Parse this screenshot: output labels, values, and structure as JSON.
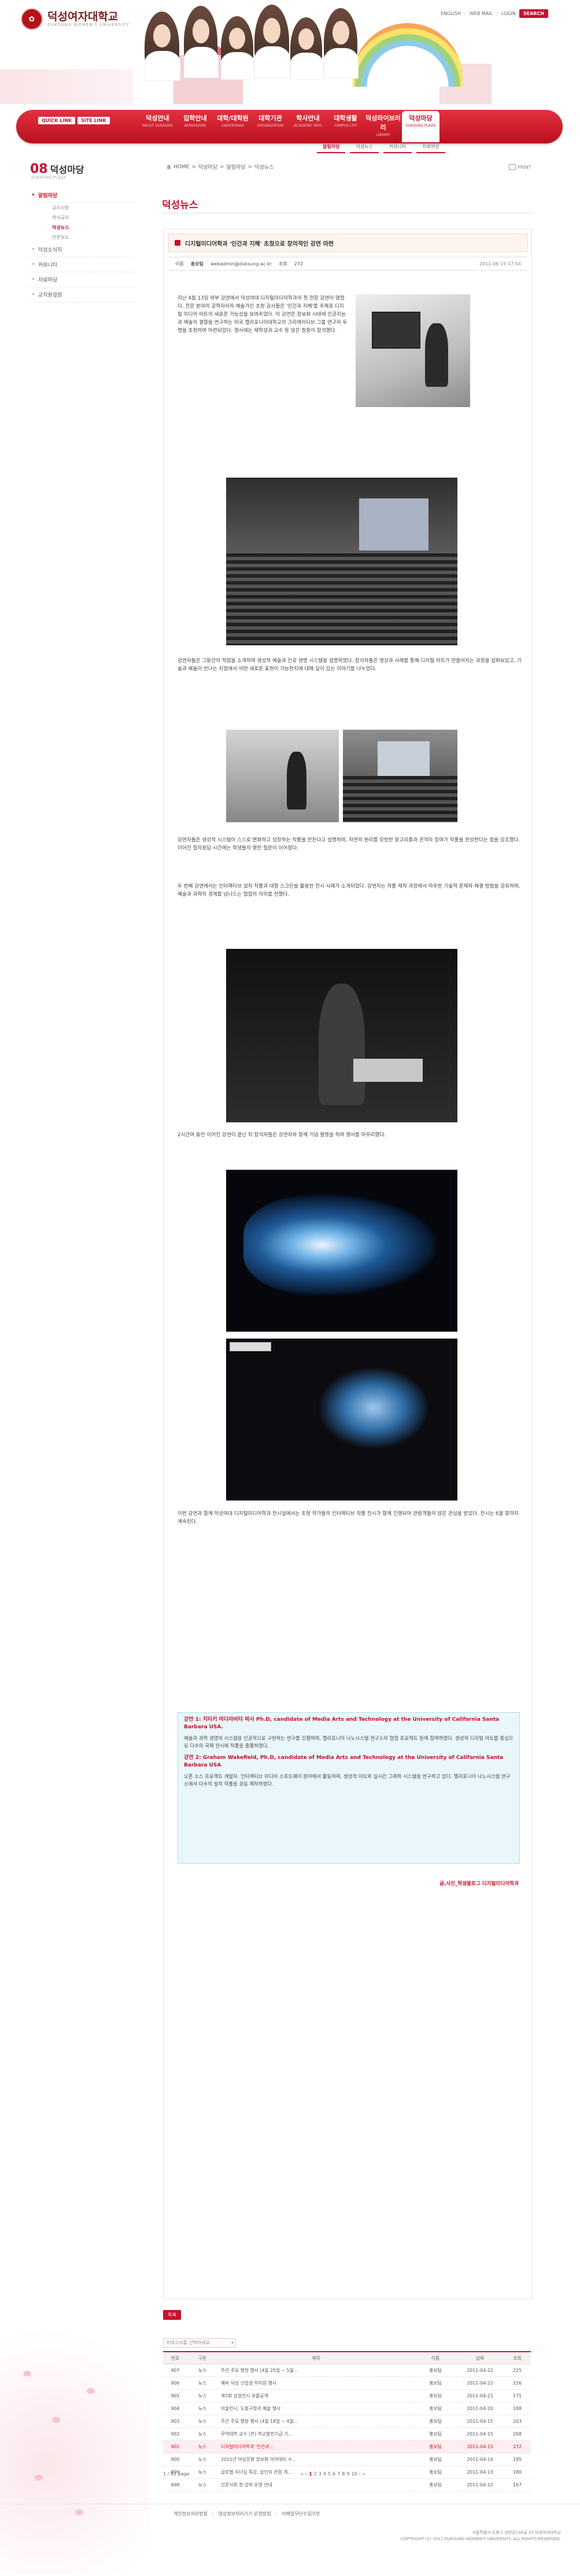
{
  "header": {
    "logo_text": "덕성여자대학교",
    "logo_sub": "DUKSUNG WOMEN'S UNIVERSITY",
    "util_links": [
      "ENGLISH",
      "WEB MAIL",
      "LOGIN"
    ],
    "search_label": "SEARCH",
    "quick_links": [
      "QUICK LINK",
      "SITE LINK"
    ],
    "menu": [
      {
        "label": "덕성안내",
        "sub": "ABOUT DUKSUNG"
      },
      {
        "label": "입학안내",
        "sub": "ADMISSIONS"
      },
      {
        "label": "대학/대학원",
        "sub": "UNDERGRAD"
      },
      {
        "label": "대학기관",
        "sub": "ORGANIZATION"
      },
      {
        "label": "학사안내",
        "sub": "ACADEMIC INFO"
      },
      {
        "label": "대학생활",
        "sub": "CAMPUS LIFE"
      },
      {
        "label": "덕성라이브러리",
        "sub": "LIBRARY"
      },
      {
        "label": "덕성마당",
        "sub": "DUKSUNG PLAZA"
      }
    ],
    "submenu": [
      "알림마당",
      "덕성뉴스",
      "커뮤니티",
      "자료마당"
    ]
  },
  "left_nav": {
    "number": "08",
    "title": "덕성마당",
    "subtitle": "DUKSUNG PLAZA",
    "items": [
      {
        "label": "알림마당",
        "active": true,
        "children": [
          {
            "label": "공지사항",
            "active": false
          },
          {
            "label": "학사공지",
            "active": false
          },
          {
            "label": "덕성뉴스",
            "active": true
          },
          {
            "label": "언론보도",
            "active": false
          }
        ]
      },
      {
        "label": "덕성소식지",
        "active": false,
        "children": []
      },
      {
        "label": "커뮤니티",
        "active": false,
        "children": []
      },
      {
        "label": "자료마당",
        "active": false,
        "children": []
      },
      {
        "label": "교직원광장",
        "active": false,
        "children": []
      }
    ]
  },
  "breadcrumb": [
    "HOME",
    "덕성마당",
    "알림마당",
    "덕성뉴스"
  ],
  "print_label": "PRINT",
  "page_title": "덕성뉴스",
  "article": {
    "title": "디지털미디어학과 '인간과 지혜' 초청으로 창의적인 강연 마련",
    "meta": {
      "author_label": "이름",
      "author": "홍보팀",
      "email": "webadmin@duksung.ac.kr",
      "hits_label": "조회",
      "hits": "272",
      "date": "2011-06-15 17:54"
    },
    "paragraph_1": "지난 4월 13일 외부 강연에서 덕성여대 디지털미디어학과의 첫 전문 강연이 열렸다. 전문 분야의 공학자이자 예술가인 초청 강사들은 '인간과 지혜'를 주제로 디지털 미디어 아트의 새로운 가능성을 보여주었다. 이 강연은 정보화 시대에 인공지능과 예술의 결합을 연구하는 미국 캘리포니아대학교의 크리에이티브 그룹 연구자 두 명을 초청하여 마련되었다. 행사에는 재학생과 교수 등 많은 청중이 참석했다.",
    "paragraph_2": "강연자들은 그동안의 작업을 소개하며 생성적 예술과 인공 생명 시스템을 설명하였다. 참석자들은 영상과 사례를 통해 디지털 아트가 만들어지는 과정을 살펴보았고, 기술과 예술이 만나는 지점에서 어떤 새로운 표현이 가능한지에 대해 깊이 있는 이야기를 나누었다.",
    "paragraph_3": "강연자들은 생성적 시스템이 스스로 변화하고 성장하는 작품을 만든다고 설명하며, 자연의 원리를 모방한 알고리즘과 관객의 참여가 작품을 완성한다는 점을 강조했다. 이어진 질의응답 시간에는 학생들의 열띤 질문이 이어졌다.",
    "paragraph_4": "두 번째 강연에서는 인터랙티브 설치 작품과 대형 스크린을 활용한 전시 사례가 소개되었다. 강연자는 작품 제작 과정에서 마주한 기술적 문제와 해결 방법을 공유하며, 예술과 과학의 경계를 넘나드는 협업의 의미를 전했다.",
    "paragraph_5": "2시간여 동안 이어진 강연이 끝난 뒤 참석자들은 강연자와 함께 기념 촬영을 하며 행사를 마무리했다.",
    "paragraph_6": "이번 강연과 함께 덕성여대 디지털미디어학과 전시실에서는 초청 작가들의 인터랙티브 작품 전시가 함께 진행되어 관람객들의 많은 관심을 받았다. 전시는 6월 말까지 계속된다.",
    "box_head_1": "강연 1: 지타키 마다라비타 박사 Ph.D, candidate of Media Arts and Technology at the University of California Santa Barbara USA.",
    "box_text_1": "예술과 과학 생명의 시스템을 인공적으로 구현하는 연구를 진행하며, 캘리포니아 나노시스템 연구소의 협업 프로젝트 등에 참여하였다. 생성적 디지털 아트를 중심으로 다수의 국제 전시에 작품을 출품하였다.",
    "box_head_2": "강연 2: Graham Wakefield, Ph.D, candidate of Media Arts and Technology at the University of California Santa Barbara USA",
    "box_text_2": "오픈 소스 프로젝트 개발자. 인터랙티브 미디어 소프트웨어 분야에서 활동하며, 생성적 아트와 실시간 그래픽 시스템을 연구하고 있다. 캘리포니아 나노시스템 연구소에서 다수의 설치 작품을 공동 제작하였다.",
    "credit": "글,사진_학생블로그 디지털미디어학과"
  },
  "list_button": "목록",
  "select_placeholder": "카테고리를 선택하세요",
  "table": {
    "headers": [
      "번호",
      "구분",
      "제목",
      "이름",
      "날짜",
      "조회"
    ],
    "rows": [
      {
        "num": "907",
        "cat": "뉴스",
        "title": "주간 주요 행정 행사 (4월 25일 ~ 5월...",
        "name": "홍보팀",
        "date": "2011-04-22",
        "hits": "225",
        "current": false
      },
      {
        "num": "906",
        "cat": "뉴스",
        "title": "예비 덕성 신입생 하이원 행사",
        "name": "홍보팀",
        "date": "2011-04-22",
        "hits": "226",
        "current": false
      },
      {
        "num": "905",
        "cat": "뉴스",
        "title": "제3회 상설전시 유물공개",
        "name": "홍보팀",
        "date": "2011-04-21",
        "hits": "171",
        "current": false
      },
      {
        "num": "904",
        "cat": "뉴스",
        "title": "미술전시, 도봉구청과 예술 행사",
        "name": "홍보팀",
        "date": "2011-04-20",
        "hits": "188",
        "current": false
      },
      {
        "num": "903",
        "cat": "뉴스",
        "title": "주간 주요 행정 행사 (4월 18일 ~ 4월...",
        "name": "홍보팀",
        "date": "2011-04-15",
        "hits": "203",
        "current": false
      },
      {
        "num": "902",
        "cat": "뉴스",
        "title": "무역대학 교수 (전) 학교발전기금 기...",
        "name": "홍보팀",
        "date": "2011-04-15",
        "hits": "208",
        "current": false
      },
      {
        "num": "901",
        "cat": "뉴스",
        "title": "디지털미디어학과 '인간과...",
        "name": "홍보팀",
        "date": "2011-04-15",
        "hits": "272",
        "current": true
      },
      {
        "num": "900",
        "cat": "뉴스",
        "title": "2011년 여성문화 정보화 아카데미 수...",
        "name": "홍보팀",
        "date": "2011-04-14",
        "hits": "195",
        "current": false
      },
      {
        "num": "899",
        "cat": "뉴스",
        "title": "글로벌 리더십 특강, 삼인의 관점 개...",
        "name": "홍보팀",
        "date": "2011-04-13",
        "hits": "180",
        "current": false
      },
      {
        "num": "898",
        "cat": "뉴스",
        "title": "인문사회 창 강좌 운영 안내",
        "name": "홍보팀",
        "date": "2011-04-12",
        "hits": "167",
        "current": false
      }
    ]
  },
  "pager_info": "1 / 91 page",
  "pager": {
    "pages": [
      "1",
      "2",
      "3",
      "4",
      "5",
      "6",
      "7",
      "8",
      "9",
      "10"
    ],
    "current": "1"
  },
  "footer": {
    "links": [
      "개인정보처리방침",
      "영상정보처리기기 운영방침",
      "이메일무단수집거부"
    ],
    "address": "서울특별시 도봉구 삼양로144길 33 덕성여자대학교",
    "copyright": "COPYRIGHT (C) 2011 DUKSUNG WOMEN'S UNIVERSITY. ALL RIGHTS RESERVED."
  }
}
